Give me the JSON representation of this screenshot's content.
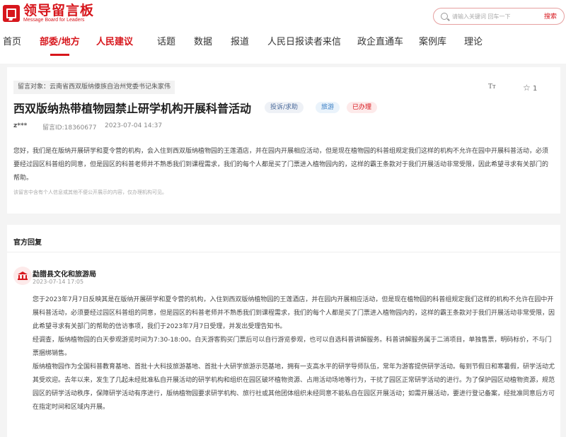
{
  "site": {
    "logo_title": "领导留言板",
    "logo_subtitle": "Message Board for Leaders"
  },
  "search": {
    "placeholder": "请输入关键词 回车一下",
    "button_label": "搜索"
  },
  "nav": {
    "items": [
      {
        "label": "首页"
      },
      {
        "label": "部委/地方",
        "active": true
      },
      {
        "label": "人民建议"
      },
      {
        "label": "话题"
      },
      {
        "label": "数据"
      },
      {
        "label": "报道"
      },
      {
        "label": "人民日报读者来信"
      },
      {
        "label": "政企直通车"
      },
      {
        "label": "案例库"
      },
      {
        "label": "理论"
      }
    ]
  },
  "message": {
    "target": "留言对象：云南省西双版纳傣族自治州党委书记朱家伟",
    "font_tool_label": "Tт",
    "favorite_count": "1",
    "title": "西双版纳热带植物园禁止研学机构开展科普活动",
    "badges": {
      "type": "投诉/求助",
      "category": "旅游",
      "status": "已办理"
    },
    "user": "z***",
    "id_text": "留言ID:18360677",
    "time": "2023-07-04 14:37",
    "body": "您好，我们是在版纳开展研学和夏令营的机构，会入住到西双版纳植物园的王莲酒店，并在园内开展相应活动，但是现在植物园的科普组规定我们这样的机构不允许在园中开展科普活动，必须要经过园区科普组的同意，但是园区的科普老师并不熟悉我们到课程需求，我们的每个人都是买了门票进入植物园内的，这样的霸王条款对于我们开展活动非常受限，因此希望寻求有关部门的帮助。",
    "note": "该留言中含有个人信息或其他不便公开展示的内容，仅办理机构可见。"
  },
  "reply": {
    "heading": "官方回复",
    "org_name": "勐腊县文化和旅游局",
    "time": "2023-07-14 17:05",
    "paragraphs": [
      "您于2023年7月7日反映其是在版纳开展研学和夏令营的机构，入住到西双版纳植物园的王莲酒店，并在园内开展相应活动，但是现在植物园的科普组规定我们这样的机构不允许在园中开展科普活动，必须要经过园区科普组的同意，但是园区的科普老师并不熟悉我们到课程需求，我们的每个人都是买了门票进入植物园内的，这样的霸王条款对于我们开展活动非常受限，因此希望寻求有关部门的帮助的信访事项，我们于2023年7月7日受理，并发出受理告知书。",
      "经调查，版纳植物园的白天参观游览时间为7:30-18:00。白天游客购买门票后可以自行游览参观，也可以自选科普讲解服务。科普讲解服务属于二消项目，单独售票，明码标价，不与门票捆绑销售。",
      "版纳植物园作为全国科普教育基地、首批十大科技旅游基地、首批十大研学旅游示范基地，拥有一支高水平的研学导师队伍，常年为游客提供研学活动。每到节假日和寒暑假，研学活动尤其受欢迎。去年以来，发生了几起未经批准私自开展活动的研学机构和组织在园区破坏植物资源、占用活动场地等行为，干扰了园区正常研学活动的进行。为了保护园区动植物资源，规范园区的研学活动秩序，保障研学活动有序进行，版纳植物园要求研学机构、旅行社或其他团体组织未经同意不能私自在园区开展活动；如需开展活动，要进行登记备案，经批准同意后方可在指定时间和区域内开展。"
    ]
  }
}
